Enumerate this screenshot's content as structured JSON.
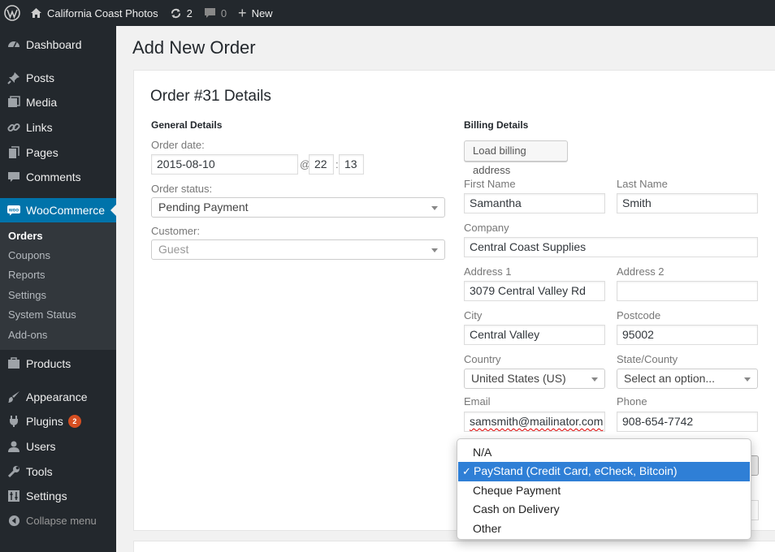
{
  "adminbar": {
    "site_name": "California Coast Photos",
    "updates_count": "2",
    "comments_count": "0",
    "new_label": "New"
  },
  "sidebar": {
    "items": [
      {
        "label": "Dashboard",
        "icon": "dashboard-icon"
      },
      {
        "label": "Posts",
        "icon": "pin-icon"
      },
      {
        "label": "Media",
        "icon": "media-icon"
      },
      {
        "label": "Links",
        "icon": "link-icon"
      },
      {
        "label": "Pages",
        "icon": "pages-icon"
      },
      {
        "label": "Comments",
        "icon": "comment-icon"
      },
      {
        "label": "WooCommerce",
        "icon": "woo-icon"
      }
    ],
    "woo_submenu": [
      "Orders",
      "Coupons",
      "Reports",
      "Settings",
      "System Status",
      "Add-ons"
    ],
    "lower_items": [
      {
        "label": "Products",
        "icon": "products-icon"
      },
      {
        "label": "Appearance",
        "icon": "brush-icon"
      },
      {
        "label": "Plugins",
        "icon": "plugin-icon",
        "badge": "2"
      },
      {
        "label": "Users",
        "icon": "user-icon"
      },
      {
        "label": "Tools",
        "icon": "wrench-icon"
      },
      {
        "label": "Settings",
        "icon": "settings-icon"
      }
    ],
    "collapse_label": "Collapse menu"
  },
  "page": {
    "title": "Add New Order",
    "order_title": "Order #31 Details"
  },
  "general": {
    "heading": "General Details",
    "order_date_label": "Order date:",
    "order_date": "2015-08-10",
    "at_sign": "@",
    "hour": "22",
    "minute": "13",
    "status_label": "Order status:",
    "status_value": "Pending Payment",
    "customer_label": "Customer:",
    "customer_value": "Guest"
  },
  "billing": {
    "heading": "Billing Details",
    "load_button": "Load billing address",
    "first_name_label": "First Name",
    "first_name": "Samantha",
    "last_name_label": "Last Name",
    "last_name": "Smith",
    "company_label": "Company",
    "company": "Central Coast Supplies",
    "address1_label": "Address 1",
    "address1": "3079 Central Valley Rd",
    "address2_label": "Address 2",
    "address2": "",
    "city_label": "City",
    "city": "Central Valley",
    "postcode_label": "Postcode",
    "postcode": "95002",
    "country_label": "Country",
    "country": "United States (US)",
    "state_label": "State/County",
    "state": "Select an option...",
    "email_label": "Email",
    "email": "samsmith@mailinator.com",
    "phone_label": "Phone",
    "phone": "908-654-7742"
  },
  "payment_dropdown": {
    "options": [
      "N/A",
      "PayStand (Credit Card, eCheck, Bitcoin)",
      "Cheque Payment",
      "Cash on Delivery",
      "Other"
    ],
    "selected_index": 1,
    "check_mark": "✓"
  },
  "colors": {
    "adminbar": "#23282d",
    "accent": "#0073aa",
    "selected_option": "#2f7fd6",
    "badge": "#d54e21"
  }
}
